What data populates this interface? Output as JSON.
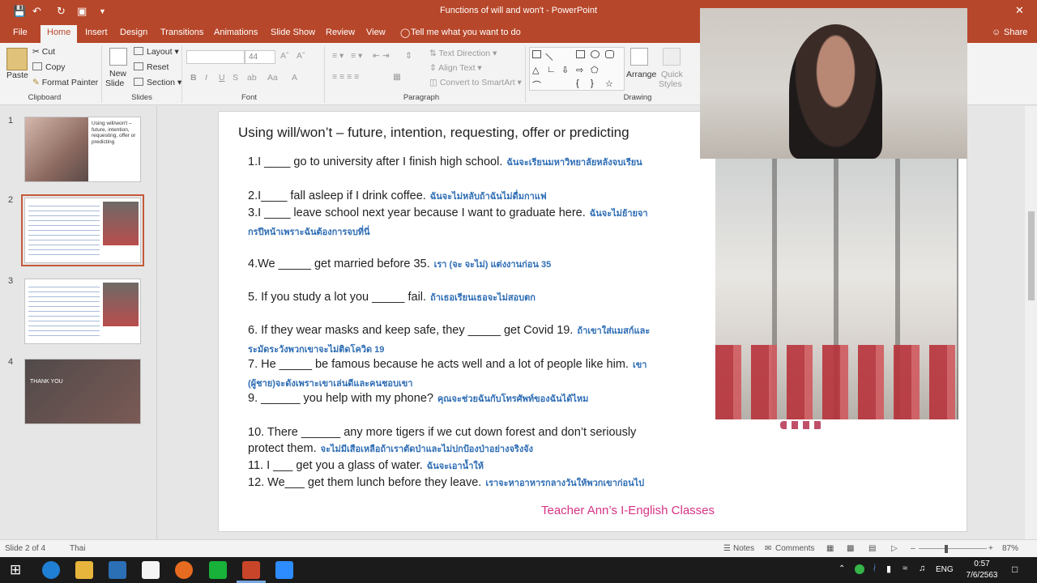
{
  "window": {
    "title": "Functions of will and won't  -  PowerPoint"
  },
  "tabs": [
    "File",
    "Home",
    "Insert",
    "Design",
    "Transitions",
    "Animations",
    "Slide Show",
    "Review",
    "View"
  ],
  "tell_me": "Tell me what you want to do",
  "share": "Share",
  "ribbon": {
    "clipboard": {
      "paste": "Paste",
      "cut": "Cut",
      "copy": "Copy",
      "format_painter": "Format Painter",
      "label": "Clipboard"
    },
    "slides": {
      "new_slide_1": "New",
      "new_slide_2": "Slide",
      "layout": "Layout",
      "reset": "Reset",
      "section": "Section",
      "label": "Slides"
    },
    "font": {
      "size": "44",
      "label": "Font",
      "bold": "B",
      "italic": "I",
      "underline": "U",
      "strike": "S"
    },
    "paragraph": {
      "text_direction": "Text Direction",
      "align_text": "Align Text",
      "smartart": "Convert to SmartArt",
      "label": "Paragraph"
    },
    "drawing": {
      "arrange": "Arrange",
      "quick_styles_1": "Quick",
      "quick_styles_2": "Styles",
      "label": "Drawing"
    }
  },
  "thumbnails": [
    {
      "num": "1",
      "title": "Using will/won't – future, intention, requesting, offer or predicting"
    },
    {
      "num": "2"
    },
    {
      "num": "3"
    },
    {
      "num": "4",
      "title": "THANK YOU"
    }
  ],
  "slide": {
    "title": "Using will/won’t – future, intention, requesting, offer or predicting",
    "lines": [
      {
        "en": "1.I ____ go to university after I finish high school.",
        "th": "ฉันจะเรียนมหาวิทยาลัยหลังจบเรียน"
      },
      {
        "en": "2.I____ fall   asleep if I drink coffee.",
        "th": "ฉันจะไม่หลับถ้าฉันไม่ดื่มกาแฟ"
      },
      {
        "en": "3.I ____ leave school next year because I want to graduate here.",
        "th": "ฉันจะไม่ย้ายจา",
        "th2": "กรปีหน้าเพราะฉันต้องการจบที่นี่"
      },
      {
        "en": "4.We _____ get married before 35.",
        "th": "เรา (จะ จะไม่) แต่งงานก่อน 35"
      },
      {
        "en": "5. If you study a lot you _____ fail.",
        "th": "ถ้าเธอเรียนเธอจะไม่สอบตก"
      },
      {
        "en": "6. If they wear masks and keep safe, they _____ get Covid  19.",
        "th": "ถ้าเขาใส่แมสก์และ",
        "th2": "ระมัดระวังพวกเขาจะไม่ติดโควิด 19"
      },
      {
        "en": "7. He _____ be famous because he acts well and a lot of people like him.",
        "th": "เขา",
        "th2": "(ผู้ชาย)จะดังเพราะเขาเล่นดีและคนชอบเขา"
      },
      {
        "en": "9. ______ you help with my phone?",
        "th": "คุณจะช่วยฉันกับโทรศัพท์ของฉันได้ไหม"
      },
      {
        "en": "10. There ______ any more tigers if we cut down forest and don’t seriously",
        "en2": "protect them.",
        "th": "จะไม่มีเสือเหลือถ้าเราตัดป่าและไม่ปกป้องป่าอย่างจริงจัง"
      },
      {
        "en": "11. I ___ get you a glass of water.",
        "th": "ฉันจะเอาน้ำให้"
      },
      {
        "en": "12. We___ get them lunch before they leave.",
        "th": "เราจะหาอาหารกลางวันให้พวกเขาก่อนไป"
      }
    ],
    "footer": "Teacher Ann’s I-English Classes"
  },
  "status": {
    "slide": "Slide 2 of 4",
    "lang": "Thai",
    "notes": "Notes",
    "comments": "Comments",
    "zoom": "87%"
  },
  "taskbar": {
    "time": "0:57",
    "date": "7/6/2563",
    "lang": "ENG"
  },
  "colors": {
    "accent": "#b7472a",
    "thai_text": "#2e6db4",
    "footer": "#d63384"
  }
}
